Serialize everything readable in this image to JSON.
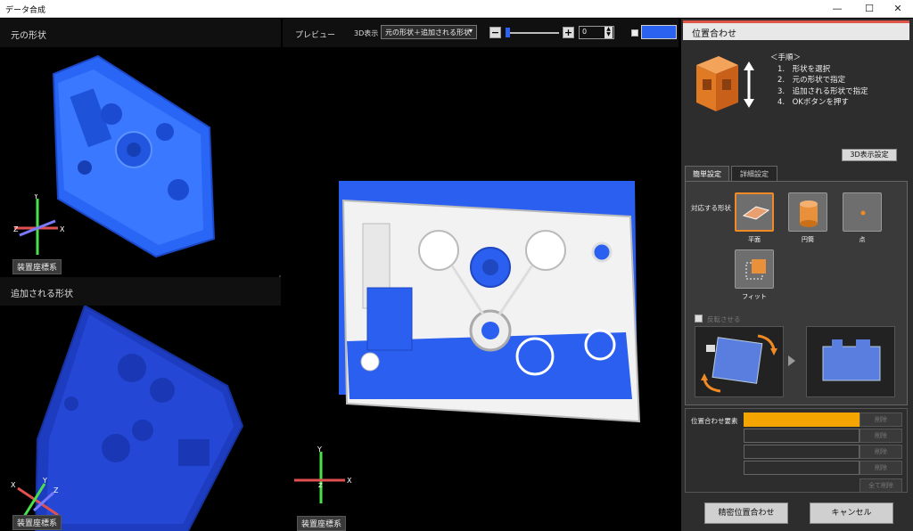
{
  "window": {
    "title": "データ合成",
    "minimize_icon": "minimize-icon",
    "maximize_icon": "maximize-icon",
    "close_icon": "close-icon"
  },
  "left": {
    "top_panel_title": "元の形状",
    "bottom_panel_title": "追加される形状",
    "coord_label": "装置座標系"
  },
  "center": {
    "title": "プレビュー",
    "display_label": "3D表示",
    "display_select": "元の形状＋追加される形状",
    "minus_label": "−",
    "plus_label": "+",
    "spin_value": "0",
    "coord_label": "装置座標系",
    "color_swatch": "#2b63f0"
  },
  "right": {
    "header": "位置合わせ",
    "accent_color": "#e0554a",
    "procedure_title": "＜手順＞",
    "steps": [
      "1.　形状を選択",
      "2.　元の形状で指定",
      "3.　追加される形状で指定",
      "4.　OKボタンを押す"
    ],
    "display_settings_button": "3D表示設定",
    "tabs": [
      "簡単設定",
      "詳細設定"
    ],
    "shape_label": "対応する形状",
    "shapes": {
      "plane": "平面",
      "cylinder": "円筒",
      "point": "点",
      "fit": "フィット"
    },
    "checkbox_label": "反転させる",
    "elements_label": "位置合わせ要素",
    "edit_buttons": [
      "削除",
      "削除",
      "削除",
      "削除"
    ],
    "clear_all_button": "全て削除",
    "highlight_color": "#f5a500",
    "precise_button": "精密位置合わせ",
    "cancel_button": "キャンセル"
  }
}
